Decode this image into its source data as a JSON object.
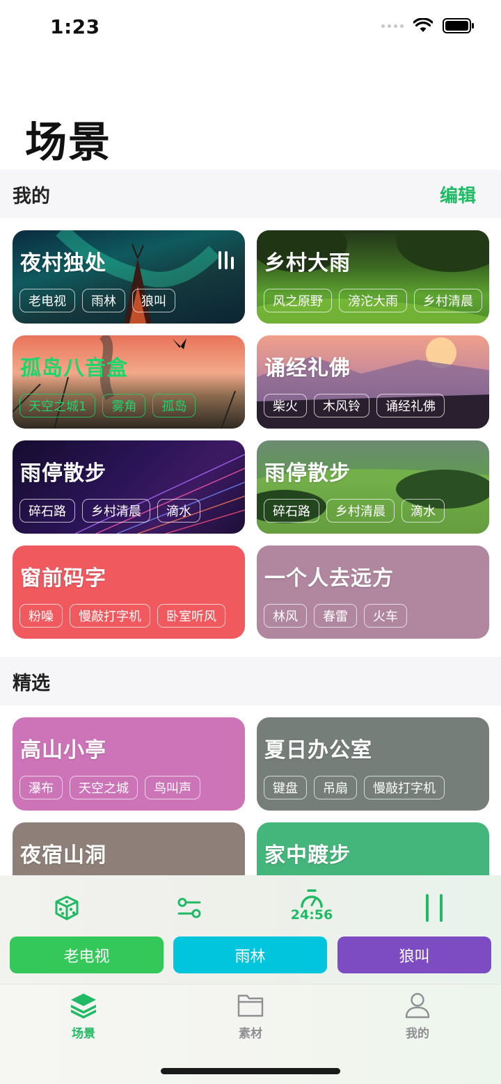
{
  "status_bar": {
    "time": "1:23"
  },
  "page": {
    "title": "场景"
  },
  "my_section": {
    "title": "我的",
    "edit_label": "编辑",
    "cards": [
      {
        "title": "夜村独处",
        "tags": [
          "老电视",
          "雨林",
          "狼叫"
        ],
        "playing": true
      },
      {
        "title": "乡村大雨",
        "tags": [
          "风之原野",
          "滂沱大雨",
          "乡村清晨"
        ]
      },
      {
        "title": "孤岛八音盒",
        "tags": [
          "天空之城1",
          "雾角",
          "孤岛"
        ]
      },
      {
        "title": "诵经礼佛",
        "tags": [
          "柴火",
          "木风铃",
          "诵经礼佛"
        ]
      },
      {
        "title": "雨停散步",
        "tags": [
          "碎石路",
          "乡村清晨",
          "滴水"
        ]
      },
      {
        "title": "雨停散步",
        "tags": [
          "碎石路",
          "乡村清晨",
          "滴水"
        ]
      },
      {
        "title": "窗前码字",
        "tags": [
          "粉噪",
          "慢敲打字机",
          "卧室听风"
        ],
        "color": "#f05a5f"
      },
      {
        "title": "一个人去远方",
        "tags": [
          "林风",
          "春雷",
          "火车"
        ],
        "color": "#b0879f"
      }
    ]
  },
  "featured_section": {
    "title": "精选",
    "cards": [
      {
        "title": "高山小亭",
        "tags": [
          "瀑布",
          "天空之城",
          "鸟叫声"
        ],
        "color": "#cd73b7"
      },
      {
        "title": "夏日办公室",
        "tags": [
          "键盘",
          "吊扇",
          "慢敲打字机"
        ],
        "color": "#757e78"
      },
      {
        "title": "夜宿山洞",
        "tags": [],
        "color": "#8e8078"
      },
      {
        "title": "家中踱步",
        "tags": [],
        "color": "#45b67b"
      }
    ]
  },
  "player": {
    "timer": "24:56",
    "icons": [
      "dice-icon",
      "sliders-icon",
      "timer-icon",
      "pause-icon"
    ],
    "sounds": [
      {
        "label": "老电视",
        "color": "#34c759"
      },
      {
        "label": "雨林",
        "color": "#00c5dc"
      },
      {
        "label": "狼叫",
        "color": "#7d4bc2"
      }
    ]
  },
  "tabbar": {
    "tabs": [
      {
        "label": "场景",
        "icon": "layers-icon",
        "active": true
      },
      {
        "label": "素材",
        "icon": "folder-icon",
        "active": false
      },
      {
        "label": "我的",
        "icon": "person-icon",
        "active": false
      }
    ],
    "accent": "#1fba63"
  }
}
